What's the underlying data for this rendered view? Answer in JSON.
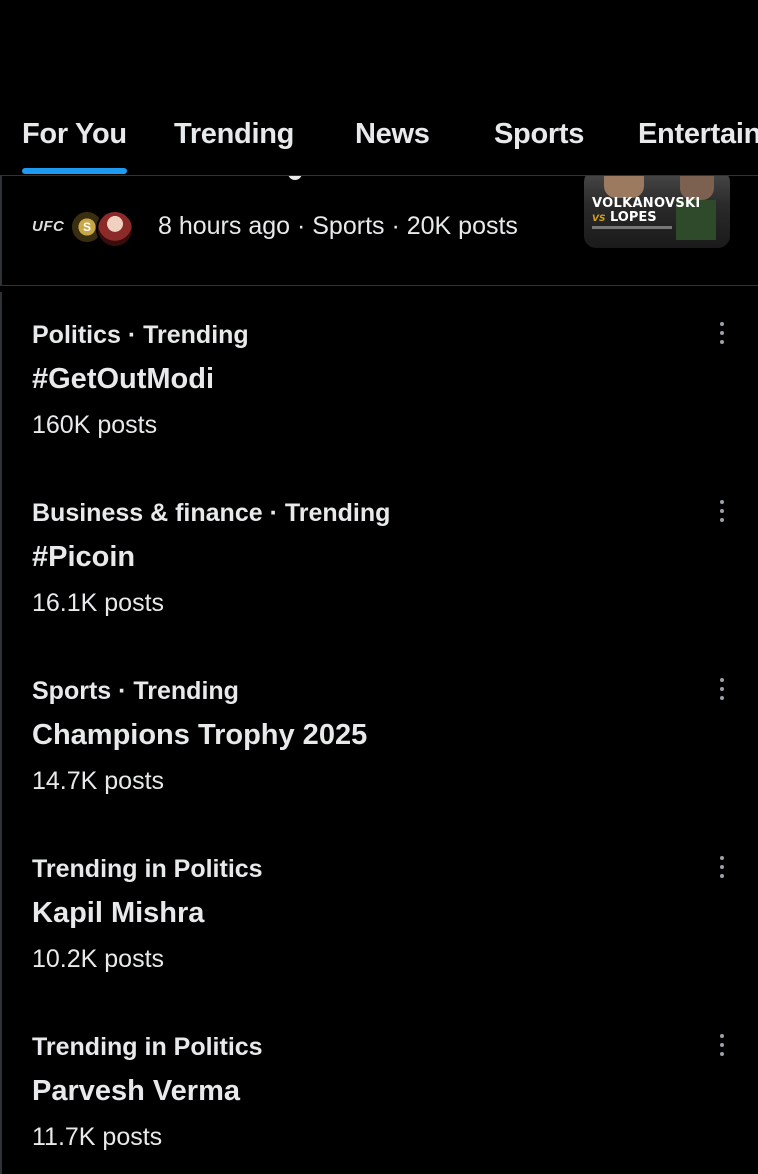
{
  "tabs": [
    {
      "label": "For You",
      "active": true
    },
    {
      "label": "Trending",
      "active": false
    },
    {
      "label": "News",
      "active": false
    },
    {
      "label": "Sports",
      "active": false
    },
    {
      "label": "Entertain",
      "active": false
    }
  ],
  "accent_color": "#1d9bf0",
  "featured": {
    "ufc_label": "UFC",
    "badge_label": "S",
    "meta": "8 hours ago · Sports · 20K posts",
    "thumbnail_line1": "VOLKANOVSKI",
    "thumbnail_vs": "VS",
    "thumbnail_line2": "LOPES"
  },
  "trends": [
    {
      "context": "Politics · Trending",
      "name": "#GetOutModi",
      "count": "160K posts"
    },
    {
      "context": "Business & finance · Trending",
      "name": "#Picoin",
      "count": "16.1K posts"
    },
    {
      "context": "Sports · Trending",
      "name": "Champions Trophy 2025",
      "count": "14.7K posts"
    },
    {
      "context": "Trending in Politics",
      "name": "Kapil Mishra",
      "count": "10.2K posts"
    },
    {
      "context": "Trending in Politics",
      "name": "Parvesh Verma",
      "count": "11.7K posts"
    }
  ],
  "icons": {
    "more": "more-vertical-icon",
    "ufc": "ufc-logo-icon",
    "avatar": "fighter-avatar-icon"
  }
}
